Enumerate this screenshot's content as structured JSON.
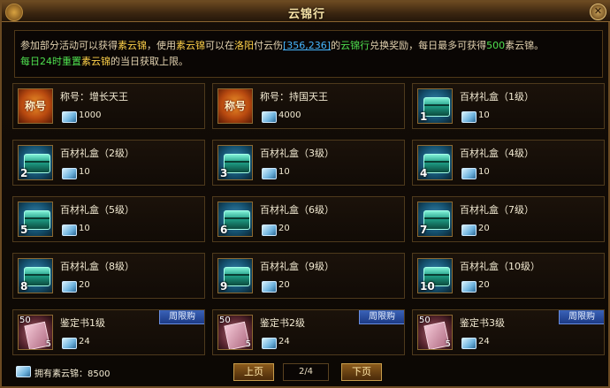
{
  "window": {
    "title": "云锦行"
  },
  "info": {
    "segments": [
      {
        "t": "参加部分活动可以获得",
        "c": ""
      },
      {
        "t": "素云锦",
        "c": "hl-y"
      },
      {
        "t": "，使用",
        "c": ""
      },
      {
        "t": "素云锦",
        "c": "hl-y"
      },
      {
        "t": "可以在",
        "c": ""
      },
      {
        "t": "洛阳",
        "c": "hl-y"
      },
      {
        "t": "付云伤",
        "c": ""
      },
      {
        "t": "[356,236]",
        "c": "hl-link"
      },
      {
        "t": "的",
        "c": ""
      },
      {
        "t": "云锦行",
        "c": "hl-g"
      },
      {
        "t": "兑换奖励，每日最多可获得",
        "c": ""
      },
      {
        "t": "500",
        "c": "hl-g"
      },
      {
        "t": "素云锦",
        "c": ""
      },
      {
        "t": "。",
        "c": ""
      },
      {
        "t": "每日24时重置",
        "c": "hl-g"
      },
      {
        "t": "素云锦",
        "c": "hl-y"
      },
      {
        "t": "的当日获取上限。",
        "c": ""
      }
    ]
  },
  "items": [
    {
      "name": "称号：增长天王",
      "cost": "1000",
      "icon": "title-icon",
      "icon_text": "称号"
    },
    {
      "name": "称号：持国天王",
      "cost": "4000",
      "icon": "title-icon",
      "icon_text": "称号"
    },
    {
      "name": "百材礼盒（1级）",
      "cost": "10",
      "icon": "box-icon",
      "level": "1"
    },
    {
      "name": "百材礼盒（2级）",
      "cost": "10",
      "icon": "box-icon",
      "level": "2"
    },
    {
      "name": "百材礼盒（3级）",
      "cost": "10",
      "icon": "box-icon",
      "level": "3"
    },
    {
      "name": "百材礼盒（4级）",
      "cost": "10",
      "icon": "box-icon",
      "level": "4"
    },
    {
      "name": "百材礼盒（5级）",
      "cost": "10",
      "icon": "box-icon",
      "level": "5"
    },
    {
      "name": "百材礼盒（6级）",
      "cost": "20",
      "icon": "box-icon",
      "level": "6"
    },
    {
      "name": "百材礼盒（7级）",
      "cost": "20",
      "icon": "box-icon",
      "level": "7"
    },
    {
      "name": "百材礼盒（8级）",
      "cost": "20",
      "icon": "box-icon",
      "level": "8"
    },
    {
      "name": "百材礼盒（9级）",
      "cost": "20",
      "icon": "box-icon",
      "level": "9"
    },
    {
      "name": "百材礼盒（10级）",
      "cost": "20",
      "icon": "box-icon",
      "level": "10"
    },
    {
      "name": "鉴定书1级",
      "cost": "24",
      "icon": "book-icon",
      "top_count": "50",
      "bottom_count": "5",
      "badge": "周限购"
    },
    {
      "name": "鉴定书2级",
      "cost": "24",
      "icon": "book-icon",
      "top_count": "50",
      "bottom_count": "5",
      "badge": "周限购"
    },
    {
      "name": "鉴定书3级",
      "cost": "24",
      "icon": "book-icon",
      "top_count": "50",
      "bottom_count": "5",
      "badge": "周限购"
    }
  ],
  "footer": {
    "owned_label": "拥有素云锦：8500",
    "prev_label": "上页",
    "page": "2/4",
    "next_label": "下页"
  }
}
